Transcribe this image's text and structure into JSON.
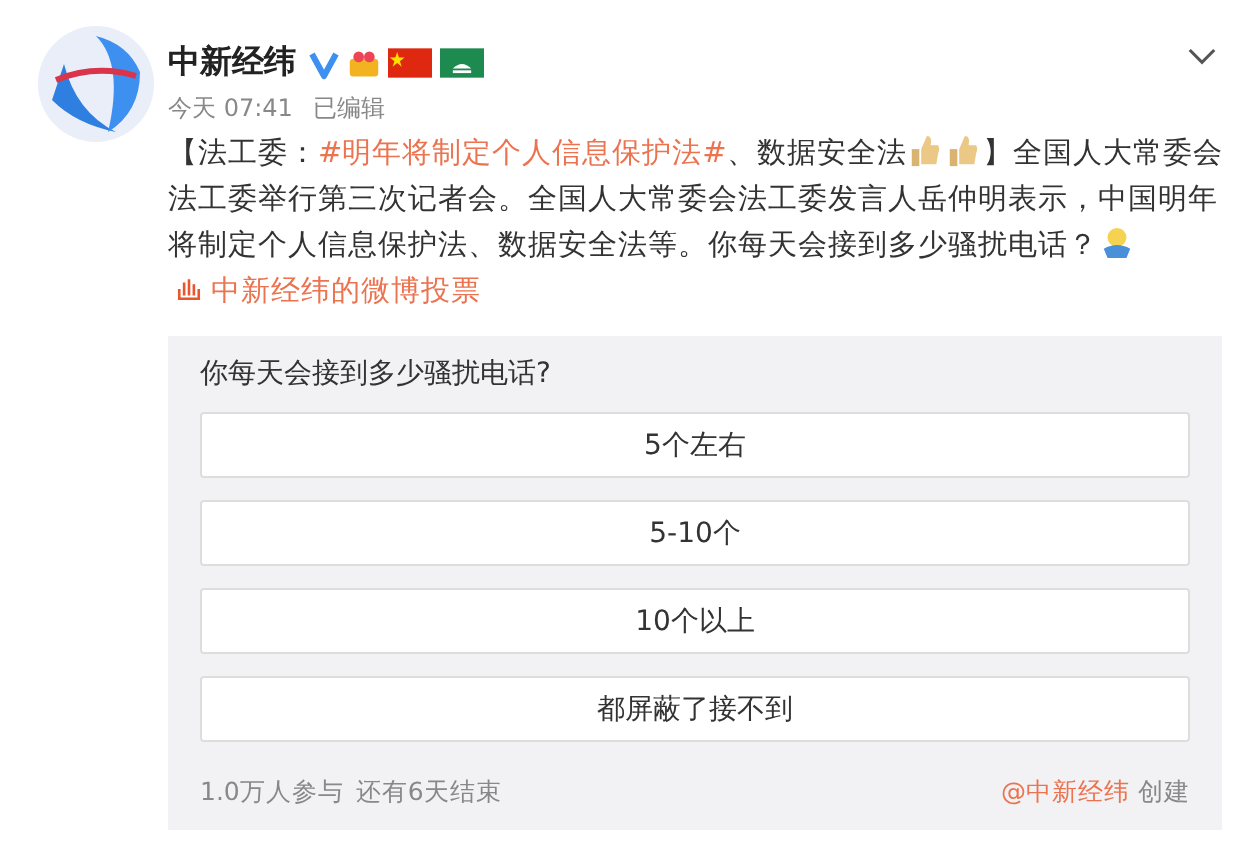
{
  "post": {
    "author": "中新经纬",
    "time": "今天 07:41",
    "edited": "已编辑",
    "body": [
      {
        "kind": "text",
        "text": "【法工委："
      },
      {
        "kind": "hashtag",
        "text": "#明年将制定个人信息保护法#"
      },
      {
        "kind": "text",
        "text": "、数据安全法"
      },
      {
        "kind": "thumb"
      },
      {
        "kind": "thumb"
      },
      {
        "kind": "text",
        "text": "】全国人大常委会法工委举行第三次记者会。全国人大常委会法工委发言人岳仲明表示，中国明年将制定个人信息保护法、数据安全法等。你每天会接到多少骚扰电话？"
      },
      {
        "kind": "figure"
      },
      {
        "kind": "link",
        "text": "中新经纬的微博投票"
      }
    ]
  },
  "poll": {
    "question": "你每天会接到多少骚扰电话?",
    "options": [
      {
        "label": "5个左右"
      },
      {
        "label": "5-10个"
      },
      {
        "label": "10个以上"
      },
      {
        "label": "都屏蔽了接不到"
      }
    ],
    "participants": "1.0万人参与",
    "remaining": "还有6天结束",
    "creator": "@中新经纬",
    "created": "创建"
  }
}
